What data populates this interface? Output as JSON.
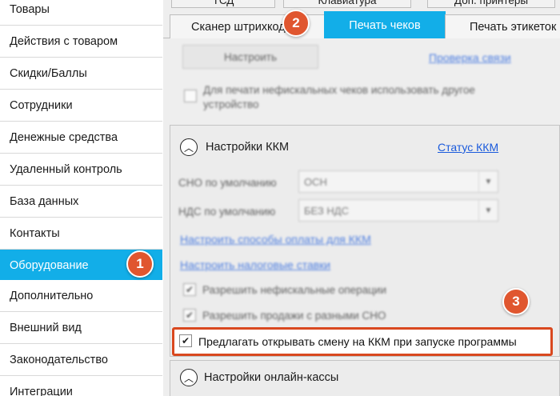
{
  "sidebar": {
    "items": [
      {
        "label": "Товары"
      },
      {
        "label": "Действия с товаром"
      },
      {
        "label": "Скидки/Баллы"
      },
      {
        "label": "Сотрудники"
      },
      {
        "label": "Денежные средства"
      },
      {
        "label": "Удаленный контроль"
      },
      {
        "label": "База данных"
      },
      {
        "label": "Контакты"
      },
      {
        "label": "Оборудование"
      },
      {
        "label": "Дополнительно"
      },
      {
        "label": "Внешний вид"
      },
      {
        "label": "Законодательство"
      },
      {
        "label": "Интеграции"
      }
    ]
  },
  "tabs_top": {
    "tsd": "ТСД",
    "keyboard": "Клавиатура",
    "printers": "Доп. принтеры"
  },
  "tabs": {
    "scanner": "Сканер штрихкодов",
    "receipts": "Печать чеков",
    "labels": "Печать этикеток"
  },
  "top_section": {
    "configure_button": "Настроить",
    "check_connection_link": "Проверка связи",
    "other_device_label": "Для печати нефискальных чеков использовать другое устройство"
  },
  "kkm_section": {
    "title": "Настройки ККМ",
    "status_link": "Статус ККМ",
    "sno_label": "СНО по умолчанию",
    "sno_value": "ОСН",
    "nds_label": "НДС по умолчанию",
    "nds_value": "БЕЗ НДС",
    "payment_methods_link": "Настроить способы оплаты для ККМ",
    "tax_rates_link": "Настроить налоговые ставки",
    "allow_nonfiscal_label": "Разрешить нефискальные операции",
    "allow_multi_sno_label": "Разрешить продажи с разными СНО",
    "offer_open_shift_label": "Предлагать открывать смену на ККМ при запуске программы"
  },
  "online_section": {
    "title": "Настройки онлайн-кассы"
  },
  "badges": {
    "one": "1",
    "two": "2",
    "three": "3"
  },
  "colors": {
    "accent": "#12aee8",
    "badge": "#e0562f",
    "highlight": "#d9481f",
    "link": "#1a5adc"
  }
}
